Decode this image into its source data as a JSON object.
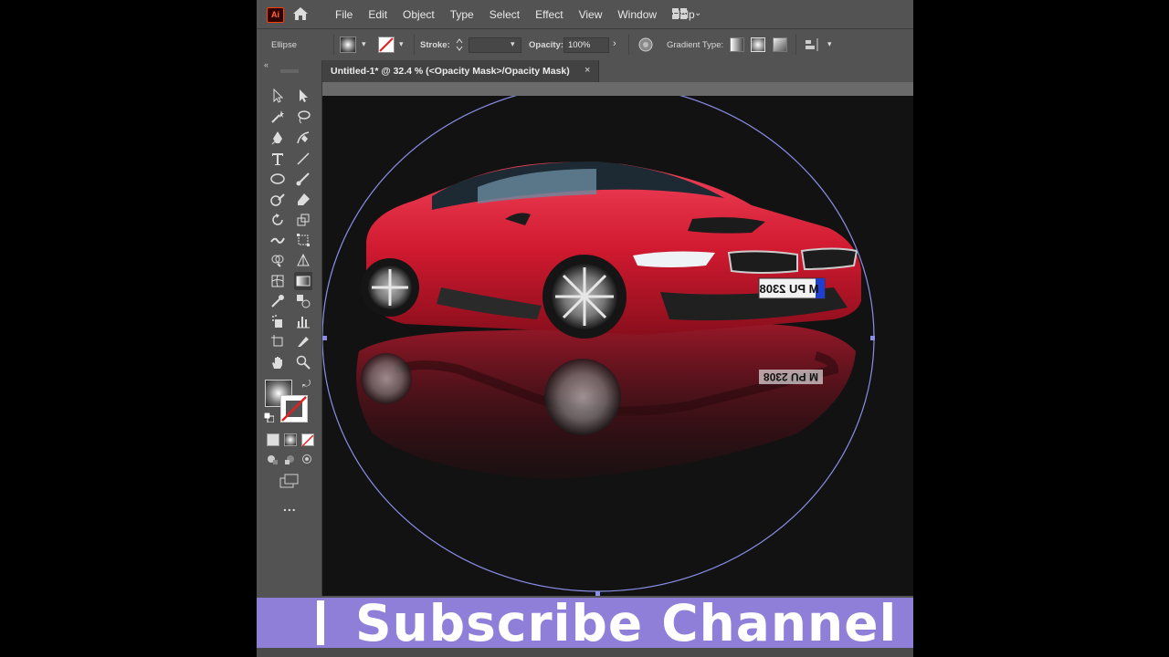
{
  "app": {
    "logo_text": "Ai"
  },
  "menu": [
    "File",
    "Edit",
    "Object",
    "Type",
    "Select",
    "Effect",
    "View",
    "Window",
    "Help"
  ],
  "control_bar": {
    "selection_label": "Ellipse",
    "stroke_label": "Stroke:",
    "opacity_label": "Opacity:",
    "opacity_value": "100%",
    "gradient_type_label": "Gradient Type:"
  },
  "document": {
    "tab_title": "Untitled-1* @ 32.4 % (<Opacity Mask>/Opacity Mask)",
    "tab_close": "×"
  },
  "artwork": {
    "license_plate": "M PU 2308"
  },
  "overlay": {
    "banner_text": "Subscribe Channel",
    "more_tools": "..."
  },
  "colors": {
    "ui_bg": "#535353",
    "canvas_bg": "#131212",
    "banner_bg": "#8f7fd9",
    "selection": "#8a8ee8",
    "car": "#d42035"
  }
}
